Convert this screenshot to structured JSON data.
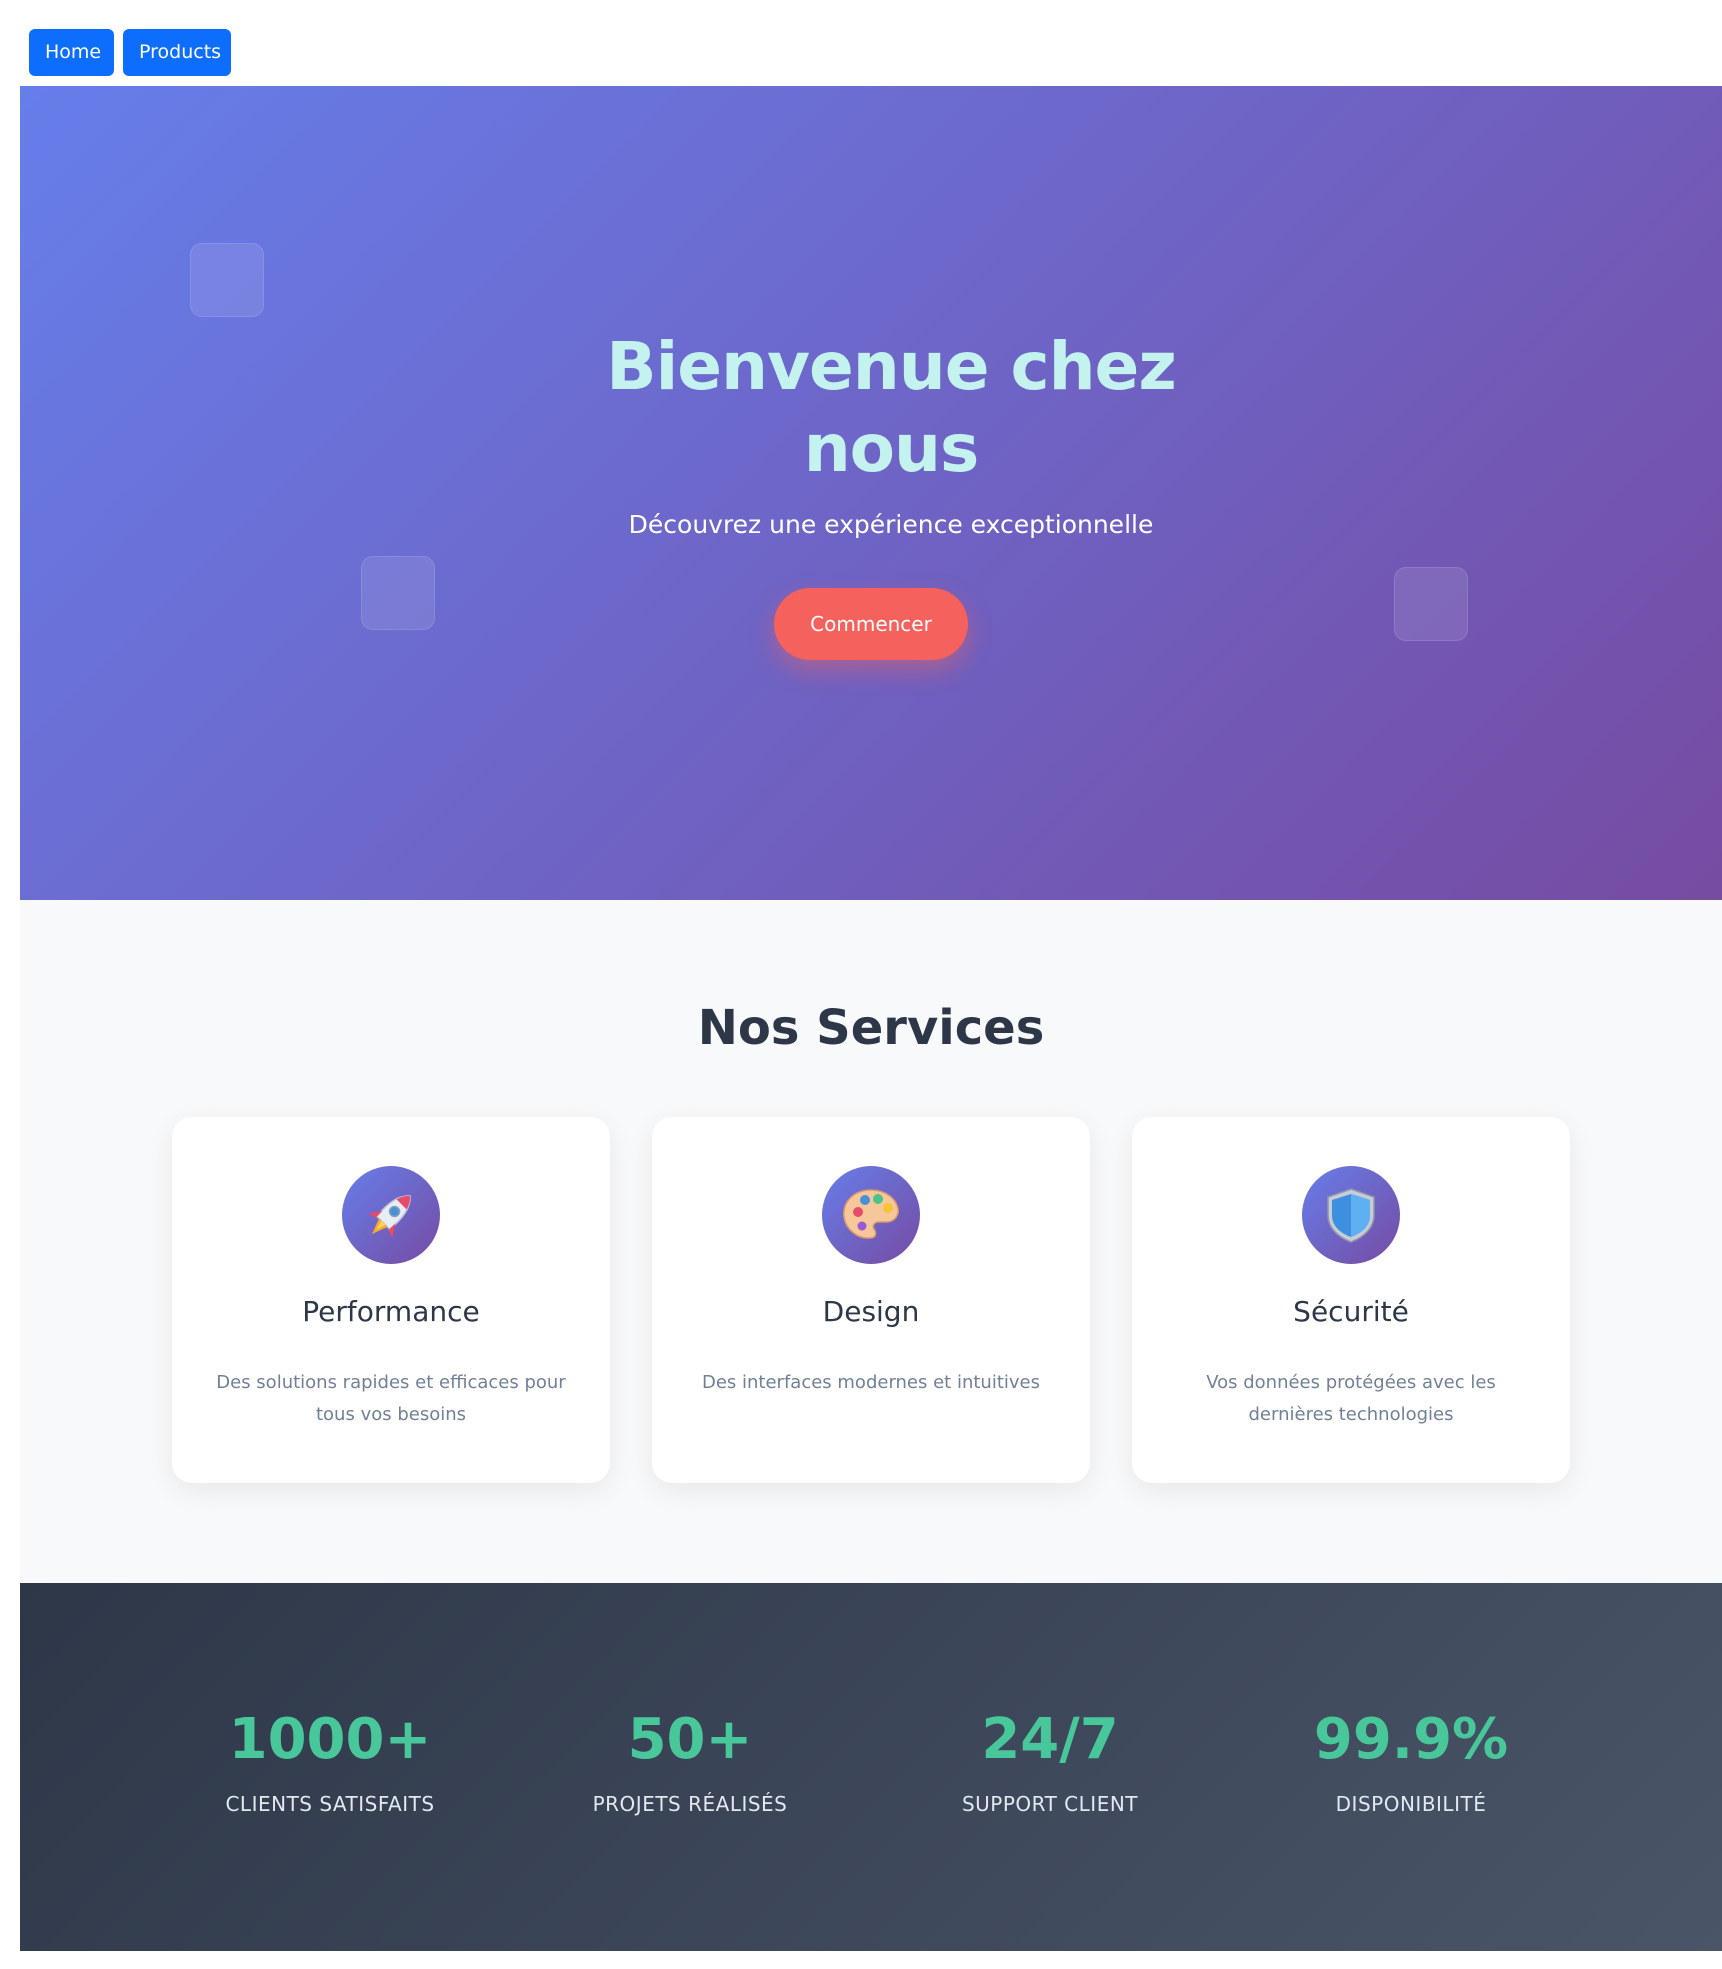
{
  "nav": {
    "home_label": "Home",
    "products_label": "Products"
  },
  "hero": {
    "title": "Bienvenue chez nous",
    "subtitle": "Découvrez une expérience exceptionnelle",
    "cta_label": "Commencer"
  },
  "services": {
    "title": "Nos Services",
    "cards": [
      {
        "icon": "rocket-icon",
        "title": "Performance",
        "description": "Des solutions rapides et efficaces pour tous vos besoins"
      },
      {
        "icon": "palette-icon",
        "title": "Design",
        "description": "Des interfaces modernes et intuitives"
      },
      {
        "icon": "shield-icon",
        "title": "Sécurité",
        "description": "Vos données protégées avec les dernières technologies"
      }
    ]
  },
  "stats": [
    {
      "value": "1000+",
      "label": "CLIENTS SATISFAITS"
    },
    {
      "value": "50+",
      "label": "PROJETS RÉALISÉS"
    },
    {
      "value": "24/7",
      "label": "SUPPORT CLIENT"
    },
    {
      "value": "99.9%",
      "label": "DISPONIBILITÉ"
    }
  ],
  "colors": {
    "nav_button": "#0d6efd",
    "hero_gradient_start": "#667eea",
    "hero_gradient_end": "#764ba2",
    "hero_title": "#c3f2ef",
    "cta": "#f5615c",
    "stat_value": "#48c79a",
    "stats_background": "#2d3748"
  }
}
